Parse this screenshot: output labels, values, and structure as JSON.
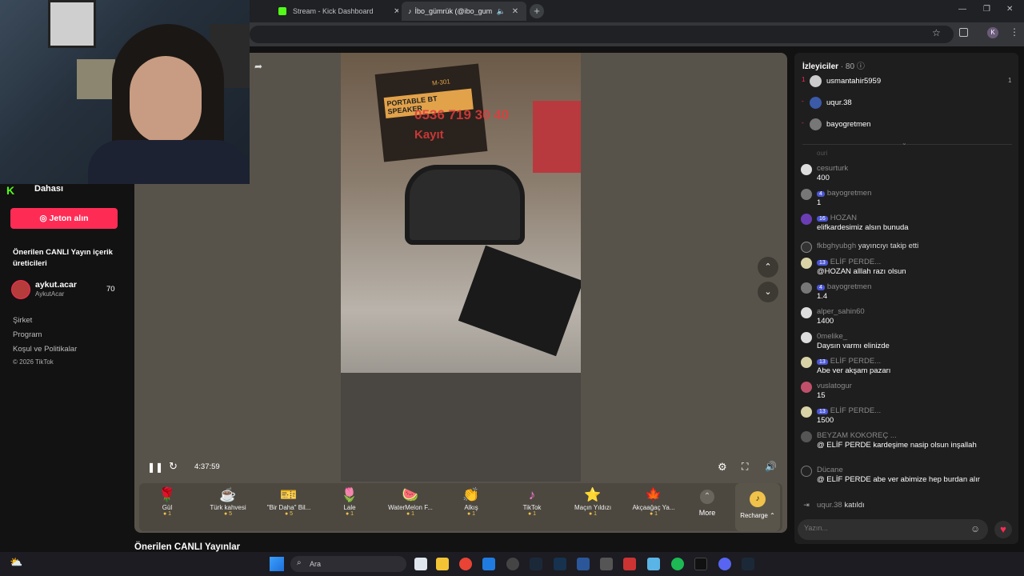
{
  "tabs": [
    {
      "label": "Stream - Kick Dashboard"
    },
    {
      "label": "İbo_gümrük (@ibo_gumruk"
    }
  ],
  "sidebar": {
    "more_label": "Dahası",
    "coin_button": "Jeton alın",
    "suggested_title": "Önerilen CANLI Yayın içerik üreticileri",
    "creator": {
      "name": "aykut.acar",
      "handle": "AykutAcar",
      "count": "70"
    },
    "links": [
      "Şirket",
      "Program",
      "Koşul ve Politikalar"
    ],
    "copyright": "© 2026 TikTok"
  },
  "player": {
    "time": "4:37:59",
    "overlay_text": {
      "box_label": "PORTABLE BT SPEAKER",
      "model": "M-301",
      "phone": "0536 719 30 40",
      "name": "Kayıt"
    }
  },
  "gifts": [
    {
      "name": "Gül",
      "price": "1",
      "icon": "🌹"
    },
    {
      "name": "Türk kahvesi",
      "price": "5",
      "icon": "☕"
    },
    {
      "name": "\"Bir Daha\" Bil...",
      "price": "5",
      "icon": "🎫"
    },
    {
      "name": "Lale",
      "price": "1",
      "icon": "🌷"
    },
    {
      "name": "WaterMelon F...",
      "price": "1",
      "icon": "🍉"
    },
    {
      "name": "Alkış",
      "price": "1",
      "icon": "👏"
    },
    {
      "name": "TikTok",
      "price": "1",
      "icon": "♪"
    },
    {
      "name": "Maçın Yıldızı",
      "price": "1",
      "icon": "⭐"
    },
    {
      "name": "Akçaağaç Ya...",
      "price": "1",
      "icon": "🍁"
    }
  ],
  "gift_more": "More",
  "recharge": "Recharge",
  "below_title": "Önerilen CANLI Yayınlar",
  "viewers": {
    "title": "İzleyiciler",
    "count": "· 80",
    "list": [
      {
        "rank": "1",
        "name": "usmantahir5959",
        "score": "1"
      },
      {
        "rank": "-",
        "name": "uqur.38",
        "score": ""
      },
      {
        "rank": "-",
        "name": "bayogretmen",
        "score": ""
      }
    ]
  },
  "chat": {
    "partial": "ouri",
    "messages": [
      {
        "name": "cesurturk",
        "badge": "",
        "text": "400"
      },
      {
        "name": "bayogretmen",
        "badge": "4",
        "text": "1"
      },
      {
        "name": "HOZAN",
        "badge": "16",
        "text": "elifkardesimiz alsın bunuda"
      },
      {
        "name": "fkbghyubgh",
        "badge": "",
        "text": "yayıncıyı takip etti"
      },
      {
        "name": "ELİF PERDE...",
        "badge": "13",
        "text": "@HOZAN alllah razı olsun"
      },
      {
        "name": "bayogretmen",
        "badge": "4",
        "text": "1.4"
      },
      {
        "name": "alper_sahin60",
        "badge": "",
        "text": "1400"
      },
      {
        "name": "0melike_",
        "badge": "",
        "text": "Daysın varmı elinizde"
      },
      {
        "name": "ELİF PERDE...",
        "badge": "13",
        "text": "Abe ver akşam pazarı"
      },
      {
        "name": "vuslatogur",
        "badge": "",
        "text": "15"
      },
      {
        "name": "ELİF PERDE...",
        "badge": "13",
        "text": "1500"
      },
      {
        "name": "BEYZAM KOKOREÇ ...",
        "badge": "",
        "text": "@ ELİF PERDE kardeşime nasip olsun inşallah"
      },
      {
        "name": "Dücane",
        "badge": "",
        "text": "@ ELİF PERDE abe ver abimize hep burdan alır"
      },
      {
        "name": "uqur.38",
        "badge": "",
        "text": "katıldı"
      }
    ],
    "input_placeholder": "Yazın..."
  },
  "taskbar": {
    "search_placeholder": "Ara"
  }
}
